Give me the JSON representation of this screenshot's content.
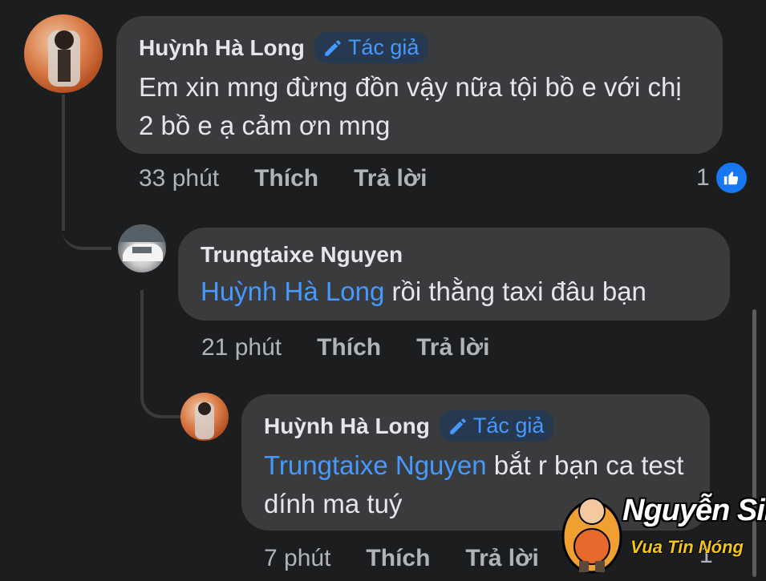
{
  "comments": [
    {
      "author": "Huỳnh Hà Long",
      "badge": "Tác giả",
      "text": "Em xin mng đừng đồn vậy nữa tội bồ e với chị 2 bồ e ạ cảm ơn mng",
      "time": "33 phút",
      "like_label": "Thích",
      "reply_label": "Trả lời",
      "reaction_count": "1"
    },
    {
      "author": "Trungtaixe Nguyen",
      "mention": "Huỳnh Hà Long",
      "text": "rồi thằng taxi đâu bạn",
      "time": "21 phút",
      "like_label": "Thích",
      "reply_label": "Trả lời"
    },
    {
      "author": "Huỳnh Hà Long",
      "badge": "Tác giả",
      "mention": "Trungtaixe Nguyen",
      "text": "bắt r bạn ca test dính ma tuý",
      "time": "7 phút",
      "like_label": "Thích",
      "reply_label": "Trả lời",
      "reaction_count": "1"
    }
  ],
  "watermark": {
    "name": "Nguyễn Sin",
    "tagline": "Vua Tin Nóng"
  },
  "colors": {
    "background": "#1c1d1f",
    "bubble": "#3a3b3c",
    "mention": "#4599ff",
    "like": "#1877f2"
  },
  "icons": {
    "badge": "pencil-icon",
    "reaction": "thumbs-up-icon"
  }
}
